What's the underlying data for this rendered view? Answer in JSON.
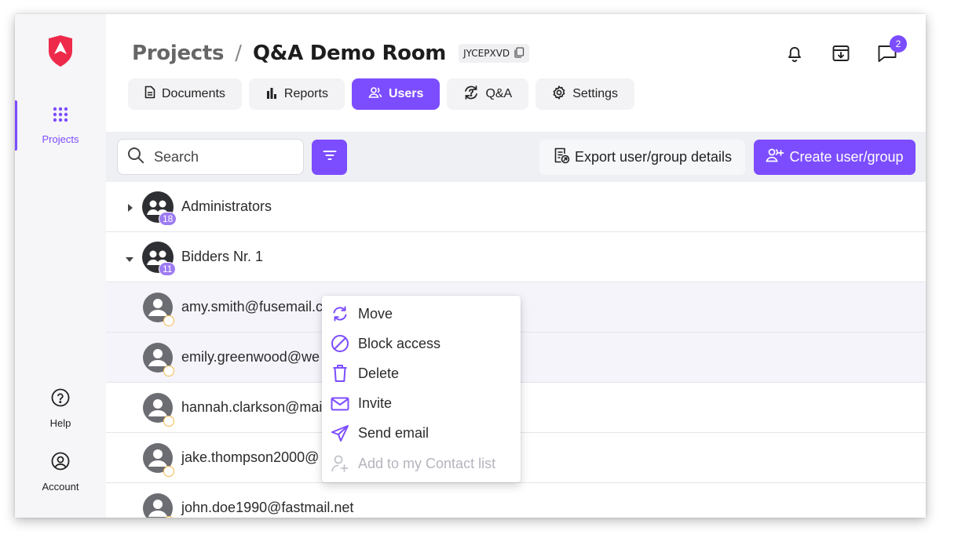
{
  "sidebar": {
    "logo": "red-shield-logo",
    "items": [
      {
        "label": "Projects",
        "icon": "grid-dots-icon",
        "active": true
      },
      {
        "label": "Help",
        "icon": "help-circle-icon"
      },
      {
        "label": "Account",
        "icon": "account-circle-icon"
      }
    ]
  },
  "header": {
    "breadcrumb_root": "Projects",
    "separator": "/",
    "room_name": "Q&A Demo Room",
    "room_code": "JYCEPXVD",
    "notification_badge": "2"
  },
  "tabs": [
    {
      "label": "Documents",
      "icon": "document-icon"
    },
    {
      "label": "Reports",
      "icon": "bar-chart-icon"
    },
    {
      "label": "Users",
      "icon": "users-icon",
      "active": true
    },
    {
      "label": "Q&A",
      "icon": "qa-cycle-icon"
    },
    {
      "label": "Settings",
      "icon": "gear-icon"
    }
  ],
  "toolbar": {
    "search_placeholder": "Search",
    "export_label": "Export user/group details",
    "create_label": "Create user/group"
  },
  "groups": [
    {
      "name": "Administrators",
      "count": "18",
      "expanded": false
    },
    {
      "name": "Bidders Nr. 1",
      "count": "11",
      "expanded": true
    }
  ],
  "users": [
    {
      "email": "amy.smith@fusemail.c"
    },
    {
      "email": "emily.greenwood@we"
    },
    {
      "email": "hannah.clarkson@mai"
    },
    {
      "email": "jake.thompson2000@"
    },
    {
      "email": "john.doe1990@fastmail.net"
    }
  ],
  "context_menu": {
    "items": [
      {
        "label": "Move",
        "icon": "move-arrows-icon",
        "disabled": false
      },
      {
        "label": "Block access",
        "icon": "block-icon",
        "disabled": false
      },
      {
        "label": "Delete",
        "icon": "trash-icon",
        "disabled": false
      },
      {
        "label": "Invite",
        "icon": "envelope-icon",
        "disabled": false
      },
      {
        "label": "Send email",
        "icon": "send-icon",
        "disabled": false
      },
      {
        "label": "Add to my Contact list",
        "icon": "add-contact-icon",
        "disabled": true
      }
    ]
  },
  "colors": {
    "accent": "#7c4dff",
    "logo": "#ee2a4b",
    "status_pending": "#f3b94a"
  }
}
